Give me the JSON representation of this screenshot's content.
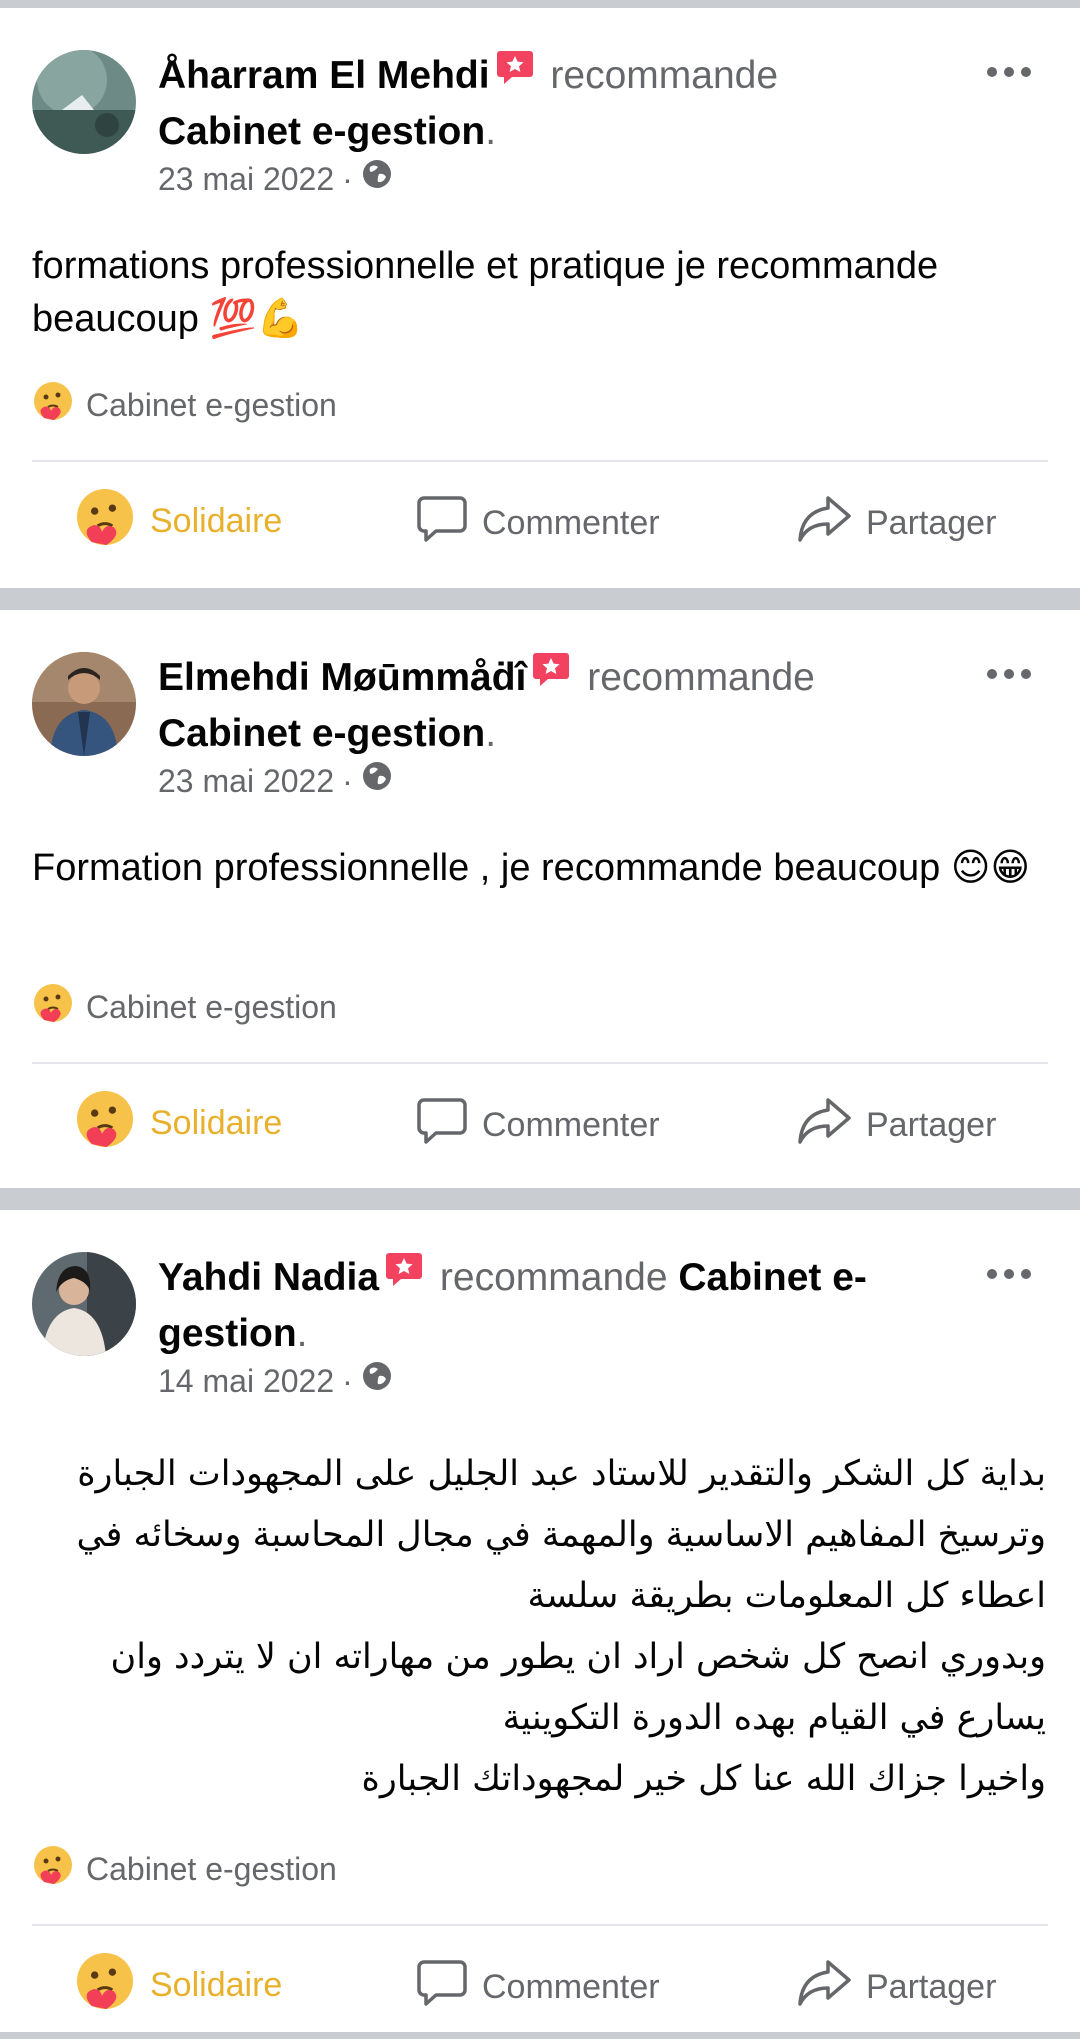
{
  "posts": [
    {
      "author": "Åharram El Mehdi",
      "verb": "recommande",
      "page": "Cabinet e-gestion",
      "period": ".",
      "date": "23 mai 2022",
      "separator": "·",
      "text": "formations professionnelle et pratique je recommande beaucoup 💯💪",
      "reaction_page": "Cabinet e-gestion",
      "actions": {
        "react": "Solidaire",
        "comment": "Commenter",
        "share": "Partager"
      }
    },
    {
      "author": "Elmehdi Møūmmåḋî",
      "verb": "recommande",
      "page": "Cabinet e-gestion",
      "period": ".",
      "date": "23 mai 2022",
      "separator": "·",
      "text": "Formation professionnelle , je recommande beaucoup 😊😁",
      "reaction_page": "Cabinet e-gestion",
      "actions": {
        "react": "Solidaire",
        "comment": "Commenter",
        "share": "Partager"
      }
    },
    {
      "author": "Yahdi Nadia",
      "verb": "recommande",
      "page": "Cabinet e-gestion",
      "period": ".",
      "date": "14 mai 2022",
      "separator": "·",
      "text_lines": [
        "بداية كل الشكر والتقدير للاستاد عبد الجليل على المجهودات الجبارة",
        "وترسيخ المفاهيم الاساسية والمهمة في مجال المحاسبة وسخائه في",
        "اعطاء كل المعلومات بطريقة سلسة",
        "وبدوري انصح كل شخص اراد ان يطور من مهاراته ان لا يتردد وان",
        "يسارع في القيام بهده الدورة التكوينية",
        "واخيرا جزاك الله عنا كل خير لمجهوداتك الجبارة"
      ],
      "reaction_page": "Cabinet e-gestion",
      "actions": {
        "react": "Solidaire",
        "comment": "Commenter",
        "share": "Partager"
      }
    }
  ],
  "icons": {
    "recommend": "recommend-badge-icon",
    "audience": "globe-icon",
    "reaction": "care-reaction-icon",
    "comment": "comment-bubble-icon",
    "share": "share-arrow-icon",
    "more": "more-options-icon"
  },
  "colors": {
    "accent_solidaire": "#e8b02b",
    "recommend_badge": "#f3425f",
    "secondary_text": "#65676b",
    "separator": "#c9ccd1"
  }
}
